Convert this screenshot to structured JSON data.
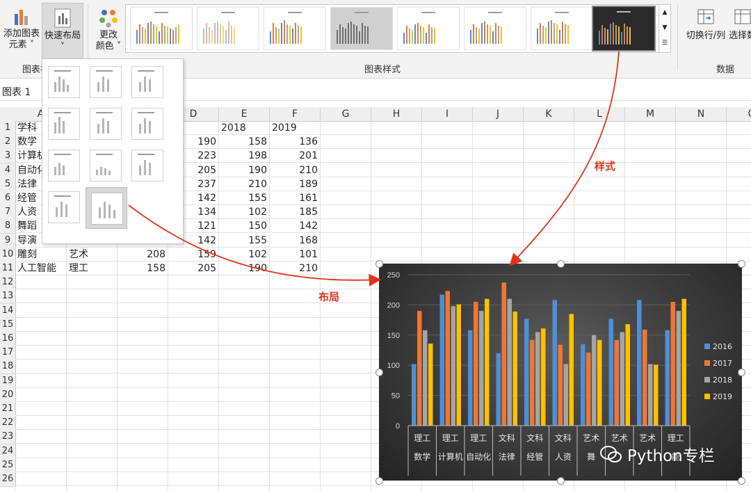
{
  "ribbon": {
    "add_chart_element": [
      "添加图表",
      "元素 ˅"
    ],
    "quick_layout": [
      "快速布局",
      "˅"
    ],
    "change_colors": [
      "更改",
      "颜色 ˅"
    ],
    "switch_row_col": "切换行/列",
    "select_data": "选择数",
    "group_chart_layouts": "图表布",
    "group_chart_styles": "图表样式",
    "group_data": "数据"
  },
  "name_box": "图表 1",
  "columns": [
    "A",
    "B",
    "C",
    "D",
    "E",
    "F",
    "G",
    "H",
    "I",
    "J",
    "K",
    "L",
    "M",
    "N",
    "O"
  ],
  "sheet_rows": [
    {
      "row": "1",
      "a": "学科",
      "b": "",
      "c": "",
      "d": "17",
      "e": "2018",
      "f": "2019"
    },
    {
      "row": "2",
      "a": "数学",
      "b": "",
      "c": "",
      "d": "190",
      "e": "158",
      "f": "136"
    },
    {
      "row": "3",
      "a": "计算机",
      "b": "",
      "c": "",
      "d": "223",
      "e": "198",
      "f": "201"
    },
    {
      "row": "4",
      "a": "自动化",
      "b": "",
      "c": "",
      "d": "205",
      "e": "190",
      "f": "210"
    },
    {
      "row": "5",
      "a": "法律",
      "b": "",
      "c": "",
      "d": "237",
      "e": "210",
      "f": "189"
    },
    {
      "row": "6",
      "a": "经管",
      "b": "",
      "c": "",
      "d": "142",
      "e": "155",
      "f": "161"
    },
    {
      "row": "7",
      "a": "人资",
      "b": "",
      "c": "",
      "d": "134",
      "e": "102",
      "f": "185"
    },
    {
      "row": "8",
      "a": "舞蹈",
      "b": "",
      "c": "",
      "d": "121",
      "e": "150",
      "f": "142"
    },
    {
      "row": "9",
      "a": "导演",
      "b": "艺术",
      "c": "177",
      "d": "142",
      "e": "155",
      "f": "168"
    },
    {
      "row": "10",
      "a": "雕刻",
      "b": "艺术",
      "c": "208",
      "d": "159",
      "e": "102",
      "f": "101"
    },
    {
      "row": "11",
      "a": "人工智能",
      "b": "理工",
      "c": "158",
      "d": "205",
      "e": "190",
      "f": "210"
    }
  ],
  "empty_rows": [
    "12",
    "13",
    "14",
    "15",
    "16",
    "17",
    "18",
    "19",
    "20",
    "21",
    "22",
    "23",
    "24",
    "25",
    "26"
  ],
  "annotations": {
    "style": "样式",
    "layout": "布局"
  },
  "watermark": "Python专栏",
  "colors": {
    "s2016": "#4e8fd6",
    "s2017": "#ee7733",
    "s2018": "#a5a5a5",
    "s2019": "#ffc000",
    "annot": "#e0331a"
  },
  "chart_data": {
    "type": "bar",
    "ylim": [
      0,
      250
    ],
    "yticks": [
      0,
      50,
      100,
      150,
      200,
      250
    ],
    "categories": [
      {
        "group": "理工",
        "name": "数学"
      },
      {
        "group": "理工",
        "name": "计算机"
      },
      {
        "group": "理工",
        "name": "自动化"
      },
      {
        "group": "文科",
        "name": "法律"
      },
      {
        "group": "文科",
        "name": "经管"
      },
      {
        "group": "文科",
        "name": "人资"
      },
      {
        "group": "艺术",
        "name": "舞"
      },
      {
        "group": "艺术",
        "name": ""
      },
      {
        "group": "艺术",
        "name": ""
      },
      {
        "group": "理工",
        "name": "能"
      }
    ],
    "series": [
      {
        "name": "2016",
        "values": [
          102,
          217,
          158,
          120,
          177,
          208,
          135,
          177,
          208,
          158
        ]
      },
      {
        "name": "2017",
        "values": [
          190,
          223,
          205,
          237,
          142,
          134,
          121,
          142,
          159,
          205
        ]
      },
      {
        "name": "2018",
        "values": [
          158,
          198,
          190,
          210,
          155,
          102,
          150,
          155,
          102,
          190
        ]
      },
      {
        "name": "2019",
        "values": [
          136,
          201,
          210,
          189,
          161,
          185,
          142,
          168,
          101,
          210
        ]
      }
    ],
    "legend_position": "right",
    "grid": true
  }
}
